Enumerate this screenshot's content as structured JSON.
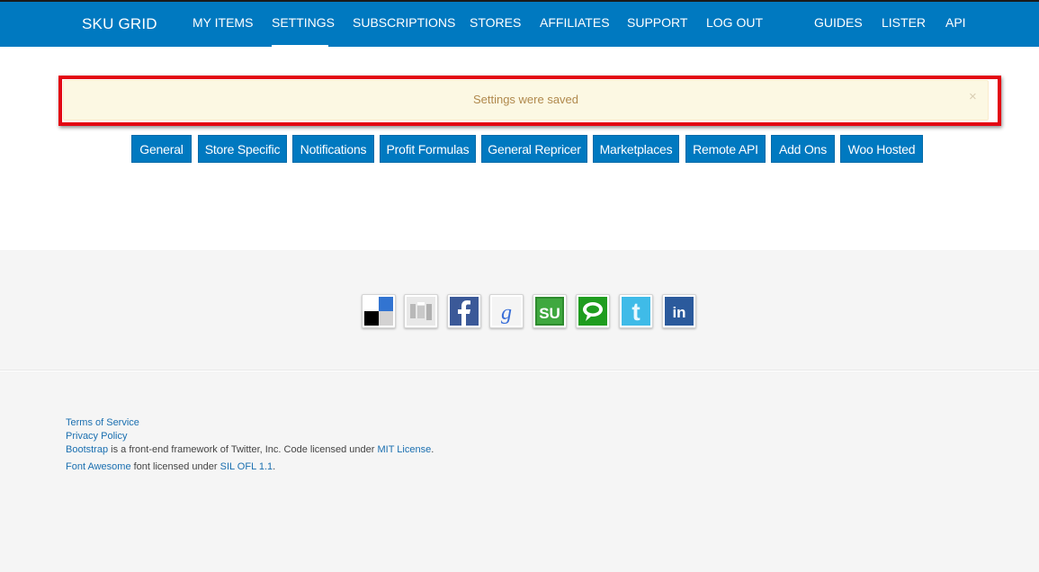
{
  "header": {
    "brand": "SKU GRID",
    "nav": [
      "MY ITEMS",
      "SETTINGS",
      "SUBSCRIPTIONS",
      "STORES",
      "AFFILIATES",
      "SUPPORT",
      "LOG OUT",
      "GUIDES",
      "LISTER",
      "API"
    ],
    "active": "SETTINGS",
    "color": "#0079c0"
  },
  "alert": {
    "message": "Settings were saved",
    "close": "×",
    "highlight_color": "#e30613"
  },
  "tabs": [
    "General",
    "Store Specific",
    "Notifications",
    "Profit Formulas",
    "General Repricer",
    "Marketplaces",
    "Remote API",
    "Add Ons",
    "Woo Hosted"
  ],
  "social_icons": [
    "delicious-icon",
    "digg-icon",
    "facebook-icon",
    "google-icon",
    "stumbleupon-icon",
    "technorati-icon",
    "twitter-icon",
    "linkedin-icon"
  ],
  "footer": {
    "terms": "Terms of Service",
    "privacy": "Privacy Policy",
    "bootstrap": {
      "link": "Bootstrap",
      "text": " is a front-end framework of Twitter, Inc. Code licensed under ",
      "license_link": "MIT License",
      "end": "."
    },
    "fontawesome": {
      "link": "Font Awesome",
      "text": " font licensed under ",
      "license_link": "SIL OFL 1.1",
      "end": "."
    }
  }
}
